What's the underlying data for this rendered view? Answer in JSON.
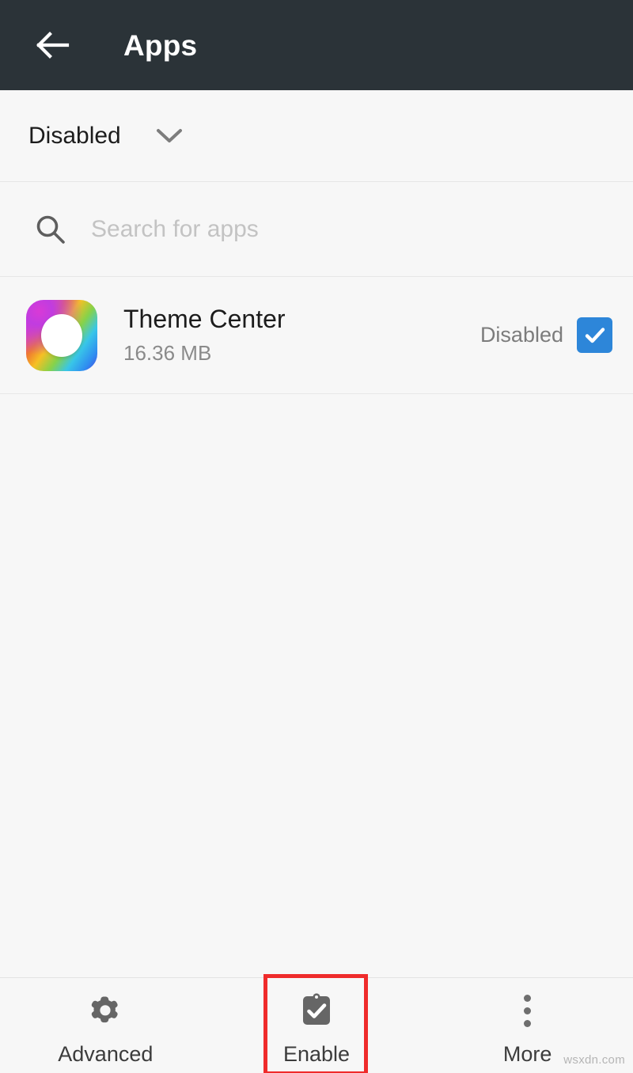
{
  "appbar": {
    "title": "Apps",
    "back_icon": "arrow-left-icon",
    "background": "#2b3338",
    "title_color": "#ffffff"
  },
  "filter": {
    "selected": "Disabled",
    "caret_icon": "chevron-down-icon",
    "options": [
      "Disabled"
    ]
  },
  "search": {
    "icon": "search-icon",
    "placeholder": "Search for apps",
    "value": ""
  },
  "app_list": {
    "items": [
      {
        "icon": "theme-center-app-icon",
        "name": "Theme Center",
        "size": "16.36 MB",
        "status": "Disabled",
        "checked": true,
        "checkbox_color": "#2d86d9"
      }
    ]
  },
  "bottom_bar": {
    "items": [
      {
        "label": "Advanced",
        "icon": "gear-icon",
        "highlighted": false
      },
      {
        "label": "Enable",
        "icon": "clipboard-check-icon",
        "highlighted": true
      },
      {
        "label": "More",
        "icon": "overflow-dots-icon",
        "highlighted": false
      }
    ],
    "highlight_color": "#ef2b2b"
  },
  "watermark": {
    "text": "wsxdn.com"
  }
}
